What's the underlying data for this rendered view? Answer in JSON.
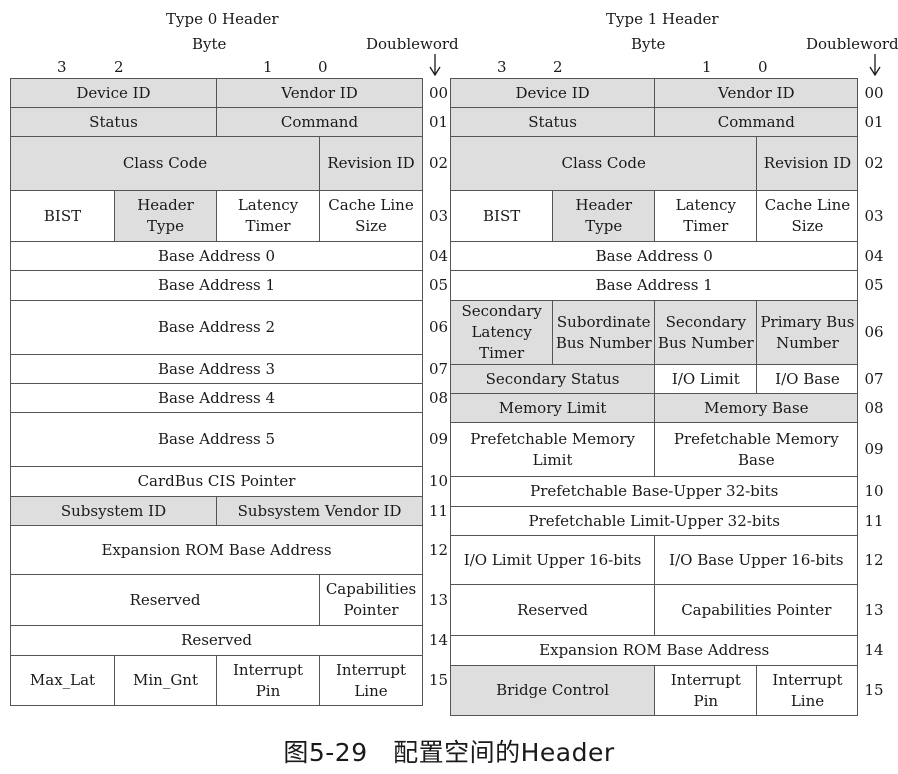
{
  "left": {
    "header_title": "Type 0 Header",
    "byte_label": "Byte",
    "doubleword_label": "Doubleword",
    "byte_numbers": [
      "3",
      "2",
      "1",
      "0"
    ],
    "rows": [
      {
        "num": "00",
        "cells": [
          {
            "t": "Device ID",
            "span": 2,
            "g": true
          },
          {
            "t": "Vendor ID",
            "span": 2,
            "g": true
          }
        ]
      },
      {
        "num": "01",
        "cells": [
          {
            "t": "Status",
            "span": 2,
            "g": true
          },
          {
            "t": "Command",
            "span": 2,
            "g": true
          }
        ]
      },
      {
        "num": "02",
        "cells": [
          {
            "t": "Class Code",
            "span": 3,
            "g": true
          },
          {
            "t": "Revision ID",
            "span": 1,
            "g": true
          }
        ]
      },
      {
        "num": "03",
        "cells": [
          {
            "t": "BIST",
            "span": 1,
            "g": false
          },
          {
            "t": "Header Type",
            "span": 1,
            "g": true
          },
          {
            "t": "Latency Timer",
            "span": 1,
            "g": false
          },
          {
            "t": "Cache Line Size",
            "span": 1,
            "g": false
          }
        ]
      },
      {
        "num": "04",
        "cells": [
          {
            "t": "Base Address 0",
            "span": 4,
            "g": false
          }
        ]
      },
      {
        "num": "05",
        "cells": [
          {
            "t": "Base Address 1",
            "span": 4,
            "g": false
          }
        ]
      },
      {
        "num": "06",
        "cells": [
          {
            "t": "Base Address 2",
            "span": 4,
            "g": false
          }
        ]
      },
      {
        "num": "07",
        "cells": [
          {
            "t": "Base Address 3",
            "span": 4,
            "g": false
          }
        ]
      },
      {
        "num": "08",
        "cells": [
          {
            "t": "Base Address 4",
            "span": 4,
            "g": false
          }
        ]
      },
      {
        "num": "09",
        "cells": [
          {
            "t": "Base Address 5",
            "span": 4,
            "g": false
          }
        ]
      },
      {
        "num": "10",
        "cells": [
          {
            "t": "CardBus CIS Pointer",
            "span": 4,
            "g": false
          }
        ]
      },
      {
        "num": "11",
        "cells": [
          {
            "t": "Subsystem ID",
            "span": 2,
            "g": true
          },
          {
            "t": "Subsystem Vendor ID",
            "span": 2,
            "g": true
          }
        ]
      },
      {
        "num": "12",
        "cells": [
          {
            "t": "Expansion ROM Base Address",
            "span": 4,
            "g": false
          }
        ]
      },
      {
        "num": "13",
        "cells": [
          {
            "t": "Reserved",
            "span": 3,
            "g": false
          },
          {
            "t": "Capabilities Pointer",
            "span": 1,
            "g": false
          }
        ]
      },
      {
        "num": "14",
        "cells": [
          {
            "t": "Reserved",
            "span": 4,
            "g": false
          }
        ]
      },
      {
        "num": "15",
        "cells": [
          {
            "t": "Max_Lat",
            "span": 1,
            "g": false
          },
          {
            "t": "Min_Gnt",
            "span": 1,
            "g": false
          },
          {
            "t": "Interrupt Pin",
            "span": 1,
            "g": false
          },
          {
            "t": "Interrupt Line",
            "span": 1,
            "g": false
          }
        ]
      }
    ]
  },
  "right": {
    "header_title": "Type 1 Header",
    "byte_label": "Byte",
    "doubleword_label": "Doubleword",
    "byte_numbers": [
      "3",
      "2",
      "1",
      "0"
    ],
    "rows": [
      {
        "num": "00",
        "cells": [
          {
            "t": "Device ID",
            "span": 2,
            "g": true
          },
          {
            "t": "Vendor ID",
            "span": 2,
            "g": true
          }
        ]
      },
      {
        "num": "01",
        "cells": [
          {
            "t": "Status",
            "span": 2,
            "g": true
          },
          {
            "t": "Command",
            "span": 2,
            "g": true
          }
        ]
      },
      {
        "num": "02",
        "cells": [
          {
            "t": "Class Code",
            "span": 3,
            "g": true
          },
          {
            "t": "Revision ID",
            "span": 1,
            "g": true
          }
        ]
      },
      {
        "num": "03",
        "cells": [
          {
            "t": "BIST",
            "span": 1,
            "g": false
          },
          {
            "t": "Header Type",
            "span": 1,
            "g": true
          },
          {
            "t": "Latency Timer",
            "span": 1,
            "g": false
          },
          {
            "t": "Cache Line Size",
            "span": 1,
            "g": false
          }
        ]
      },
      {
        "num": "04",
        "cells": [
          {
            "t": "Base Address 0",
            "span": 4,
            "g": false
          }
        ]
      },
      {
        "num": "05",
        "cells": [
          {
            "t": "Base Address 1",
            "span": 4,
            "g": false
          }
        ]
      },
      {
        "num": "06",
        "cells": [
          {
            "t": "Secondary Latency Timer",
            "span": 1,
            "g": true
          },
          {
            "t": "Subordinate Bus Number",
            "span": 1,
            "g": true
          },
          {
            "t": "Secondary Bus Number",
            "span": 1,
            "g": true
          },
          {
            "t": "Primary Bus Number",
            "span": 1,
            "g": true
          }
        ]
      },
      {
        "num": "07",
        "cells": [
          {
            "t": "Secondary Status",
            "span": 2,
            "g": true
          },
          {
            "t": "I/O Limit",
            "span": 1,
            "g": false
          },
          {
            "t": "I/O Base",
            "span": 1,
            "g": false
          }
        ]
      },
      {
        "num": "08",
        "cells": [
          {
            "t": "Memory Limit",
            "span": 2,
            "g": true
          },
          {
            "t": "Memory Base",
            "span": 2,
            "g": true
          }
        ]
      },
      {
        "num": "09",
        "cells": [
          {
            "t": "Prefetchable Memory Limit",
            "span": 2,
            "g": false
          },
          {
            "t": "Prefetchable Memory Base",
            "span": 2,
            "g": false
          }
        ]
      },
      {
        "num": "10",
        "cells": [
          {
            "t": "Prefetchable Base-Upper 32-bits",
            "span": 4,
            "g": false
          }
        ]
      },
      {
        "num": "11",
        "cells": [
          {
            "t": "Prefetchable Limit-Upper 32-bits",
            "span": 4,
            "g": false
          }
        ]
      },
      {
        "num": "12",
        "cells": [
          {
            "t": "I/O Limit Upper 16-bits",
            "span": 2,
            "g": false
          },
          {
            "t": "I/O Base Upper 16-bits",
            "span": 2,
            "g": false
          }
        ]
      },
      {
        "num": "13",
        "cells": [
          {
            "t": "Reserved",
            "span": 2,
            "g": false
          },
          {
            "t": "Capabilities Pointer",
            "span": 2,
            "g": false
          }
        ]
      },
      {
        "num": "14",
        "cells": [
          {
            "t": "Expansion ROM Base Address",
            "span": 4,
            "g": false
          }
        ]
      },
      {
        "num": "15",
        "cells": [
          {
            "t": "Bridge Control",
            "span": 2,
            "g": true
          },
          {
            "t": "Interrupt Pin",
            "span": 1,
            "g": false
          },
          {
            "t": "Interrupt Line",
            "span": 1,
            "g": false
          }
        ]
      }
    ]
  },
  "caption": "图5-29　配置空间的Header"
}
